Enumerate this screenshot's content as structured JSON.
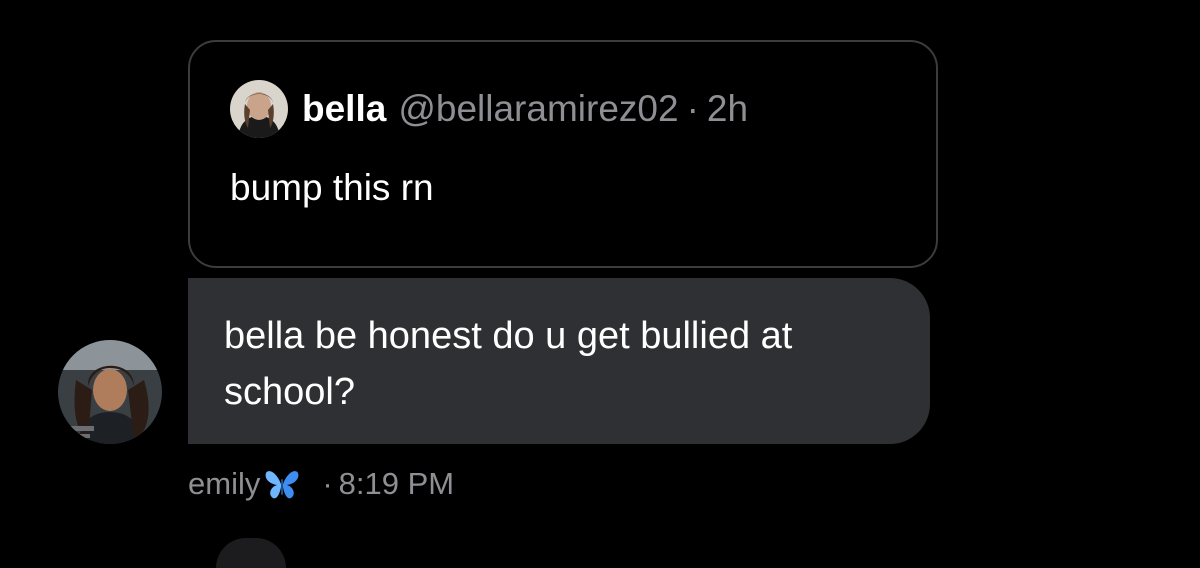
{
  "quoted_tweet": {
    "display_name": "bella",
    "handle": "@bellaramirez02",
    "separator": "·",
    "time_ago": "2h",
    "text": "bump this rn",
    "avatar_icon": "profile-photo"
  },
  "message": {
    "text": "bella be honest do u get bullied at school?",
    "bubble_color": "#2f3033",
    "sender_avatar_icon": "profile-photo"
  },
  "meta": {
    "sender_name": "emily",
    "emoji_icon": "blue-butterfly-icon",
    "separator": "·",
    "time": "8:19 PM"
  },
  "colors": {
    "background": "#000000",
    "secondary_text": "#8e8e93",
    "card_border": "#3c3c40",
    "primary_text": "#ffffff"
  }
}
